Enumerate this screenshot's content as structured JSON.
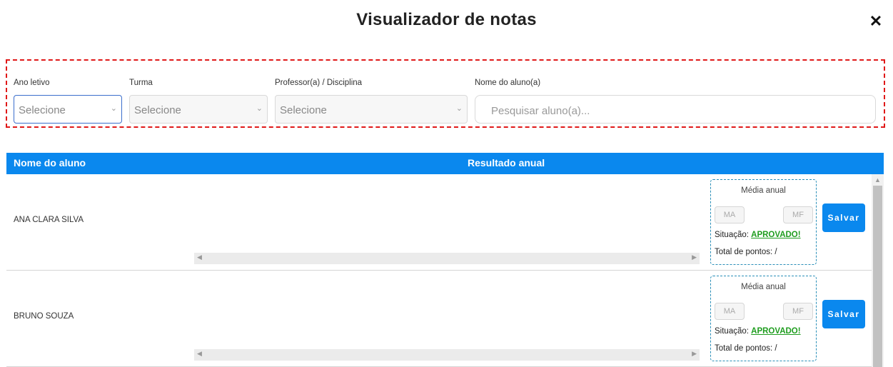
{
  "header": {
    "title": "Visualizador de notas",
    "close_symbol": "✕"
  },
  "filters": {
    "ano_letivo": {
      "label": "Ano letivo",
      "value": "Selecione"
    },
    "turma": {
      "label": "Turma",
      "value": "Selecione"
    },
    "professor": {
      "label": "Professor(a) / Disciplina",
      "value": "Selecione"
    },
    "aluno": {
      "label": "Nome do aluno(a)",
      "placeholder": "Pesquisar aluno(a)..."
    }
  },
  "table": {
    "headers": {
      "name": "Nome do aluno",
      "result": "Resultado anual"
    },
    "rows": [
      {
        "student": "ANA CLARA SILVA",
        "media_title": "Média anual",
        "ma": "MA",
        "mf": "MF",
        "situacao_label": "Situação:",
        "situacao_value": "APROVADO!",
        "total_label": "Total de pontos: /",
        "save_label": "Salvar"
      },
      {
        "student": "BRUNO SOUZA",
        "media_title": "Média anual",
        "ma": "MA",
        "mf": "MF",
        "situacao_label": "Situação:",
        "situacao_value": "APROVADO!",
        "total_label": "Total de pontos: /",
        "save_label": "Salvar"
      }
    ]
  },
  "colors": {
    "accent": "#0a88ee",
    "highlight_border": "#e01818",
    "approved": "#1f9d1f"
  },
  "icons": {
    "close": "close-icon",
    "chevron": "chevron-down-icon",
    "scroll_left": "scroll-left-arrow-icon",
    "scroll_right": "scroll-right-arrow-icon",
    "scroll_up": "scroll-up-arrow-icon"
  }
}
